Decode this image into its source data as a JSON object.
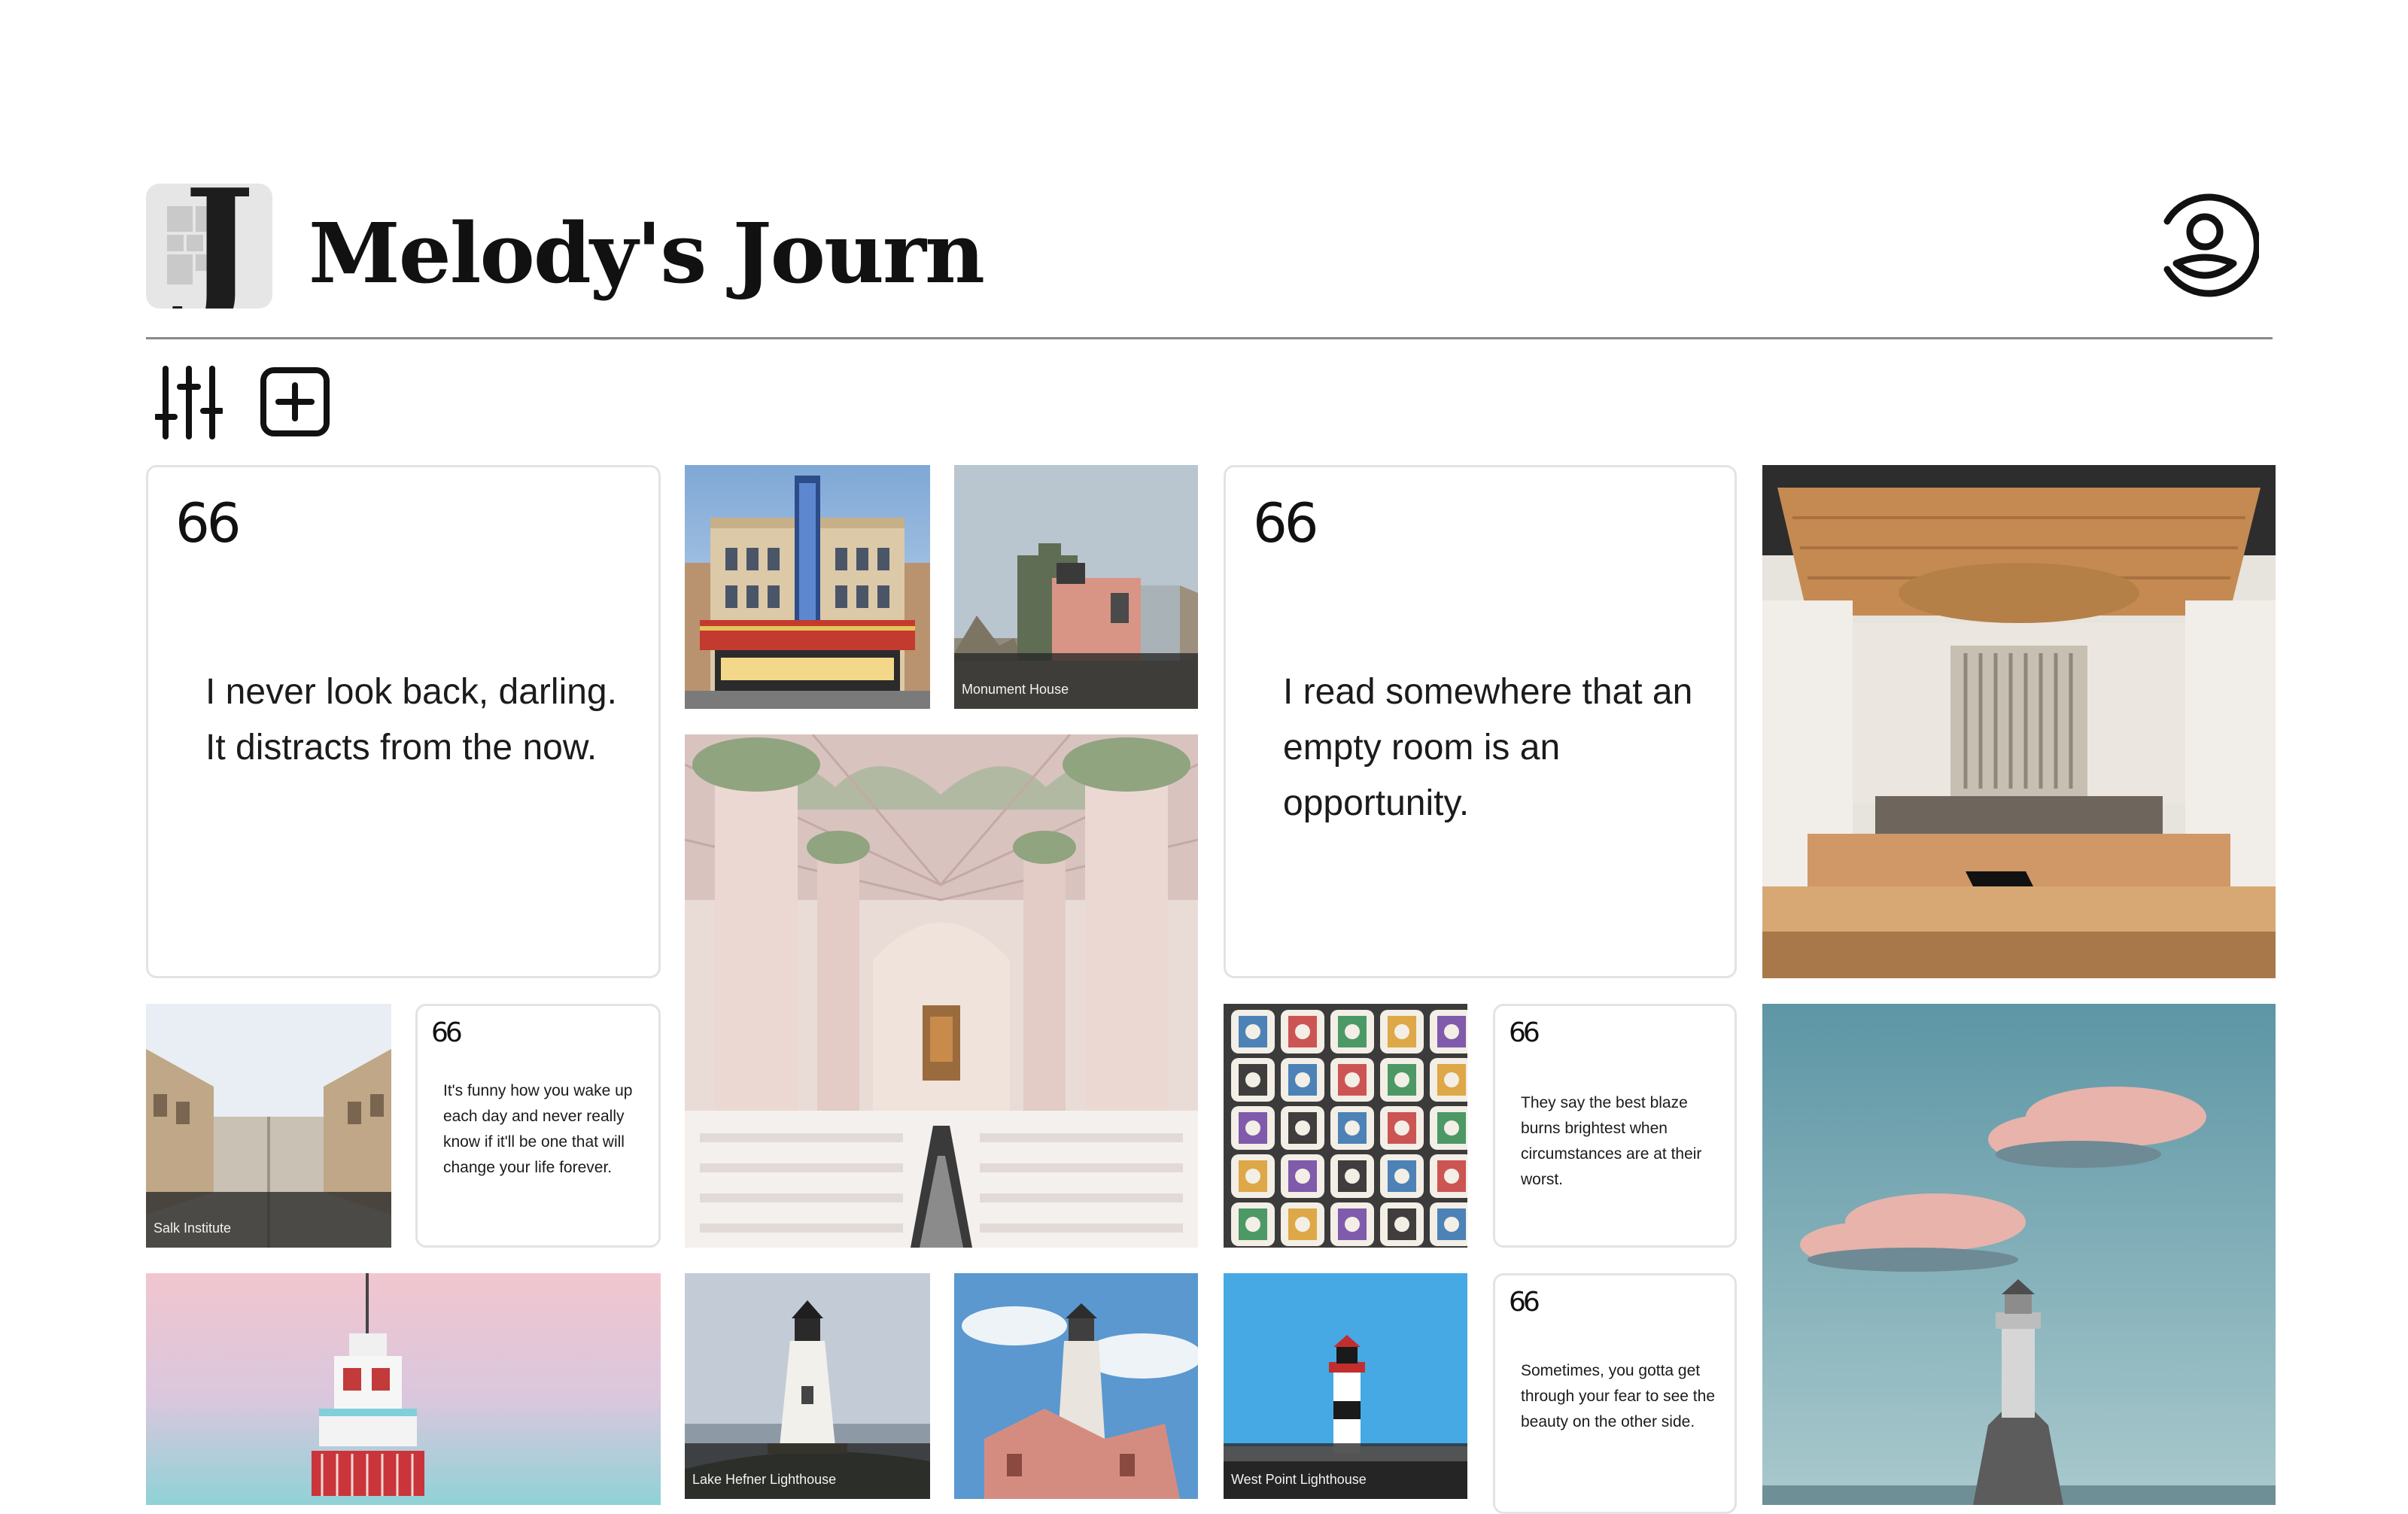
{
  "app": {
    "title": "Melody's Journ",
    "logo_letter": "J"
  },
  "header": {
    "profile_icon": "user-circle-icon"
  },
  "toolbar": {
    "filter_icon": "sliders-icon",
    "add_icon": "plus-square-icon"
  },
  "quotes": [
    {
      "mark": "66",
      "text": "I never look back, darling. It distracts from the now."
    },
    {
      "mark": "66",
      "text": "I read somewhere that an empty room is an opportunity."
    },
    {
      "mark": "66",
      "text": "It's funny how you wake up each day and never really know if it'll be one that will change your life forever."
    },
    {
      "mark": "66",
      "text": "They say the best blaze burns brightest when circumstances are at their worst."
    },
    {
      "mark": "66",
      "text": "Sometimes, you gotta get through your fear to see the beauty on the other side."
    }
  ],
  "photos": {
    "capitol_theater": {
      "caption": ""
    },
    "monument_house": {
      "caption": "Monument House"
    },
    "church_interior": {
      "caption": ""
    },
    "concert_hall": {
      "caption": ""
    },
    "salk_institute": {
      "caption": "Salk Institute"
    },
    "sake_barrels": {
      "caption": ""
    },
    "sea_lighthouse": {
      "caption": ""
    },
    "pink_lighthouse": {
      "caption": ""
    },
    "lake_hefner": {
      "caption": "Lake Hefner Lighthouse"
    },
    "ruined_lighthouse": {
      "caption": ""
    },
    "west_point": {
      "caption": "West Point Lighthouse"
    }
  },
  "colors": {
    "accent": "#111111",
    "card_border": "#e3e3e3",
    "caption_bg": "#2b2b2b"
  }
}
